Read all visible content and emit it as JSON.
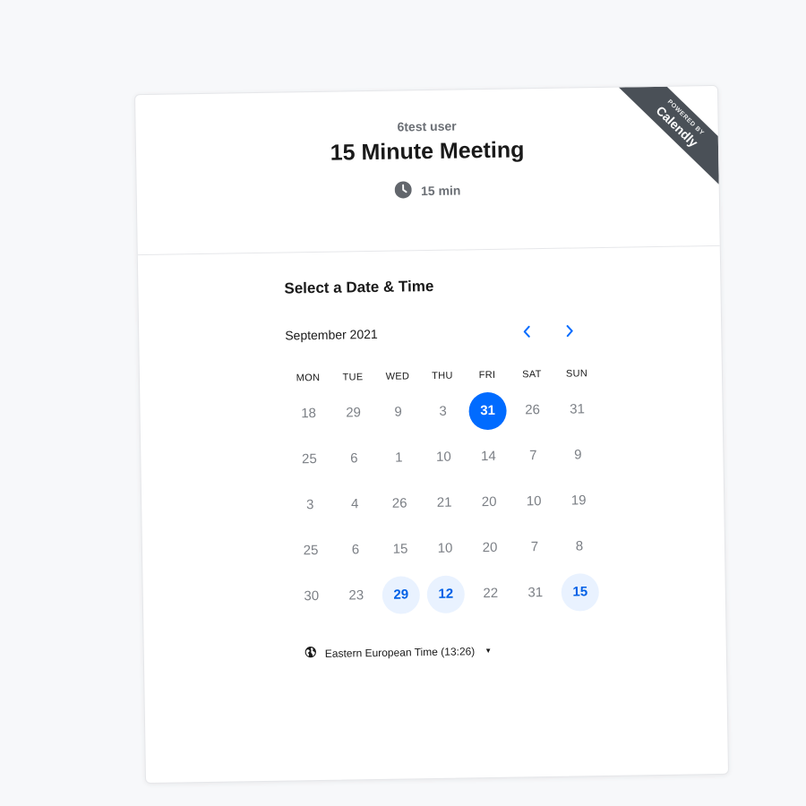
{
  "header": {
    "owner": "6test user",
    "title": "15 Minute Meeting",
    "duration": "15 min",
    "duration_icon": "clock-icon"
  },
  "ribbon": {
    "small": "POWERED BY",
    "brand": "Calendly"
  },
  "calendar": {
    "section_title": "Select a Date & Time",
    "month": "September 2021",
    "prev_icon": "chevron-left-icon",
    "next_icon": "chevron-right-icon",
    "weekdays": [
      "MON",
      "TUE",
      "WED",
      "THU",
      "FRI",
      "SAT",
      "SUN"
    ],
    "weeks": [
      [
        {
          "d": "18",
          "s": "unavailable"
        },
        {
          "d": "29",
          "s": "unavailable"
        },
        {
          "d": "9",
          "s": "unavailable"
        },
        {
          "d": "3",
          "s": "unavailable"
        },
        {
          "d": "31",
          "s": "selected"
        },
        {
          "d": "26",
          "s": "unavailable"
        },
        {
          "d": "31",
          "s": "unavailable"
        }
      ],
      [
        {
          "d": "25",
          "s": "unavailable"
        },
        {
          "d": "6",
          "s": "unavailable"
        },
        {
          "d": "1",
          "s": "unavailable"
        },
        {
          "d": "10",
          "s": "unavailable"
        },
        {
          "d": "14",
          "s": "unavailable"
        },
        {
          "d": "7",
          "s": "unavailable"
        },
        {
          "d": "9",
          "s": "unavailable"
        }
      ],
      [
        {
          "d": "3",
          "s": "unavailable"
        },
        {
          "d": "4",
          "s": "unavailable"
        },
        {
          "d": "26",
          "s": "unavailable"
        },
        {
          "d": "21",
          "s": "unavailable"
        },
        {
          "d": "20",
          "s": "unavailable"
        },
        {
          "d": "10",
          "s": "unavailable"
        },
        {
          "d": "19",
          "s": "unavailable"
        }
      ],
      [
        {
          "d": "25",
          "s": "unavailable"
        },
        {
          "d": "6",
          "s": "unavailable"
        },
        {
          "d": "15",
          "s": "unavailable"
        },
        {
          "d": "10",
          "s": "unavailable"
        },
        {
          "d": "20",
          "s": "unavailable"
        },
        {
          "d": "7",
          "s": "unavailable"
        },
        {
          "d": "8",
          "s": "unavailable"
        }
      ],
      [
        {
          "d": "30",
          "s": "unavailable"
        },
        {
          "d": "23",
          "s": "unavailable"
        },
        {
          "d": "29",
          "s": "available"
        },
        {
          "d": "12",
          "s": "available"
        },
        {
          "d": "22",
          "s": "unavailable"
        },
        {
          "d": "31",
          "s": "unavailable"
        },
        {
          "d": "15",
          "s": "available"
        }
      ]
    ]
  },
  "timezone": {
    "label": "Eastern European Time (13:26)",
    "icon": "globe-icon"
  },
  "colors": {
    "accent": "#006bff",
    "available_bg": "#e9f2ff",
    "ribbon": "#4a5057",
    "page_bg": "#f7f8fa"
  }
}
